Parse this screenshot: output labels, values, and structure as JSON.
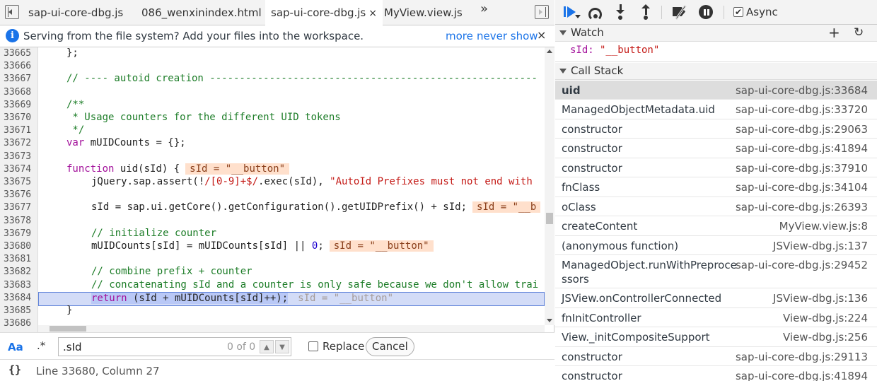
{
  "tabs": [
    {
      "label": "sap-ui-core-dbg.js",
      "active": false
    },
    {
      "label": "086_wenxinindex.html",
      "active": false
    },
    {
      "label": "sap-ui-core-dbg.js",
      "active": true
    },
    {
      "label": "MyView.view.js",
      "active": false
    }
  ],
  "tab_close_glyph": "×",
  "more_tabs_glyph": "»",
  "infobar": {
    "icon": "i",
    "text": "Serving from the file system? Add your files into the workspace.",
    "more_link": "more",
    "never_link": "never show",
    "close": "×"
  },
  "editor": {
    "line_numbers": [
      "33665",
      "33666",
      "33667",
      "33668",
      "33669",
      "33670",
      "33671",
      "33672",
      "33673",
      "33674",
      "33675",
      "33676",
      "33677",
      "33678",
      "33679",
      "33680",
      "33681",
      "33682",
      "33683",
      "33684",
      "33685",
      "33686"
    ],
    "lines": {
      "l0": "};",
      "l2": "// ---- autoid creation -------------------------------------------------------",
      "l4": "/**",
      "l5": " * Usage counters for the different UID tokens",
      "l6": " */",
      "l7_kw": "var",
      "l7_rest": " mUIDCounts = {};",
      "l9_kw": "function",
      "l9_rest": " uid(sId) {",
      "l9_inline": "sId = \"__button\"",
      "l10_a": "jQuery.sap.assert(!",
      "l10_rx": "/[0-9]+$/",
      "l10_b": ".exec(sId), ",
      "l10_s": "\"AutoId Prefixes must not end with",
      "l12": "sId = sap.ui.getCore().getConfiguration().getUIDPrefix() + sId;",
      "l12_inline": "sId = \"__b",
      "l14": "// initialize counter",
      "l15_a": "mUIDCounts[sId] = mUIDCounts[sId] || ",
      "l15_n": "0",
      "l15_b": ";",
      "l15_inline": "sId = \"__button\"",
      "l17": "// combine prefix + counter",
      "l18": "// concatenating sId and a counter is only safe because we don't allow trai",
      "l19_kw": "return",
      "l19_rest": " (sId + mUIDCounts[sId]++);",
      "l19_inline": "sId = \"__button\"",
      "l20": "}"
    }
  },
  "search": {
    "case_label": "Aa",
    "regex_label": ".*",
    "value": ".sId",
    "match_count": "0 of 0",
    "prev": "▲",
    "next": "▼",
    "replace_label": "Replace",
    "cancel_label": "Cancel"
  },
  "status": {
    "braces": "{}",
    "position": "Line 33680, Column 27"
  },
  "debugger": {
    "async_label": "Async",
    "async_checked": "✔",
    "watch_title": "Watch",
    "add_glyph": "+",
    "refresh_glyph": "↻",
    "watch_expr": "sId:",
    "watch_value": "\"__button\"",
    "callstack_title": "Call Stack",
    "frames": [
      {
        "fn": "uid",
        "loc": "sap-ui-core-dbg.js:33684"
      },
      {
        "fn": "ManagedObjectMetadata.uid",
        "loc": "sap-ui-core-dbg.js:33720"
      },
      {
        "fn": "constructor",
        "loc": "sap-ui-core-dbg.js:29063"
      },
      {
        "fn": "constructor",
        "loc": "sap-ui-core-dbg.js:41894"
      },
      {
        "fn": "constructor",
        "loc": "sap-ui-core-dbg.js:37910"
      },
      {
        "fn": "fnClass",
        "loc": "sap-ui-core-dbg.js:34104"
      },
      {
        "fn": "oClass",
        "loc": "sap-ui-core-dbg.js:26393"
      },
      {
        "fn": "createContent",
        "loc": "MyView.view.js:8"
      },
      {
        "fn": "(anonymous function)",
        "loc": "JSView-dbg.js:137"
      },
      {
        "fn": "ManagedObject.runWithPreprocessors",
        "loc": "sap-ui-core-dbg.js:29452"
      },
      {
        "fn": "JSView.onControllerConnected",
        "loc": "JSView-dbg.js:136"
      },
      {
        "fn": "fnInitController",
        "loc": "View-dbg.js:224"
      },
      {
        "fn": "View._initCompositeSupport",
        "loc": "View-dbg.js:256"
      },
      {
        "fn": "constructor",
        "loc": "sap-ui-core-dbg.js:29113"
      },
      {
        "fn": "constructor",
        "loc": "sap-ui-core-dbg.js:41894"
      }
    ]
  },
  "colors": {
    "accent": "#1a73e8",
    "keyword": "#a3119b",
    "string": "#c41a16",
    "comment": "#1d7d28",
    "exec_line": "#d3dcf7",
    "inline_value_bg": "#ffe0cc"
  }
}
